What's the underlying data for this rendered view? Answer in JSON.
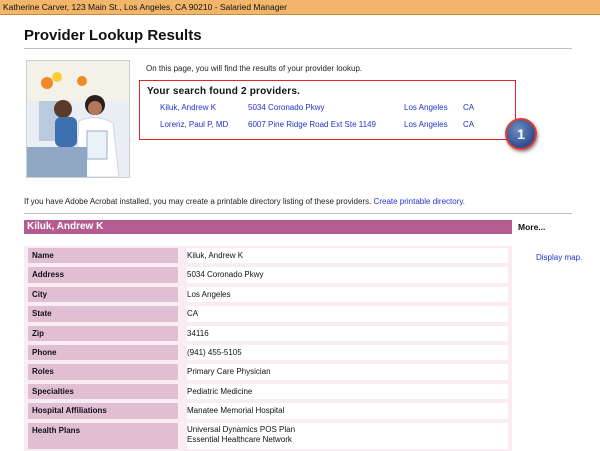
{
  "topbar": "Katherine Carver, 123 Main St., Los Angeles, CA 90210 - Salaried Manager",
  "title": "Provider Lookup Results",
  "intro": "On this page, you will find the results of your provider lookup.",
  "results": {
    "heading": "Your search found 2 providers.",
    "providers": [
      {
        "name": "Kiluk, Andrew K",
        "address": "5034 Coronado Pkwy",
        "city": "Los Angeles",
        "state": "CA"
      },
      {
        "name": "Lorenz, Paul P, MD",
        "address": "6007 Pine Ridge Road Ext Ste 1149",
        "city": "Los Angeles",
        "state": "CA"
      }
    ]
  },
  "callout_number": "1",
  "acrobat": {
    "text": "If you have Adobe Acrobat installed, you may create a printable directory listing of these providers.",
    "link": "Create printable directory."
  },
  "provider_detail": {
    "header": "Kiluk, Andrew K",
    "more": "More...",
    "display_map": "Display map.",
    "rows": [
      {
        "label": "Name",
        "value": "Kiluk, Andrew K"
      },
      {
        "label": "Address",
        "value": "5034 Coronado Pkwy"
      },
      {
        "label": "City",
        "value": "Los Angeles"
      },
      {
        "label": "State",
        "value": "CA"
      },
      {
        "label": "Zip",
        "value": "34116"
      },
      {
        "label": "Phone",
        "value": "(941) 455-5105"
      },
      {
        "label": "Roles",
        "value": "Primary Care Physician"
      },
      {
        "label": "Specialties",
        "value": "Pediatric Medicine"
      },
      {
        "label": "Hospital Affiliations",
        "value": "Manatee Memorial Hospital"
      },
      {
        "label": "Health Plans",
        "value": "Universal Dynamics POS Plan",
        "value2": "Essential Healthcare Network"
      }
    ]
  },
  "colors": {
    "topbar": "#f2b66a",
    "provider_header": "#b45b91",
    "label_cell": "#e0bfd3",
    "link": "#2233cc",
    "result_border": "#e0242a"
  }
}
